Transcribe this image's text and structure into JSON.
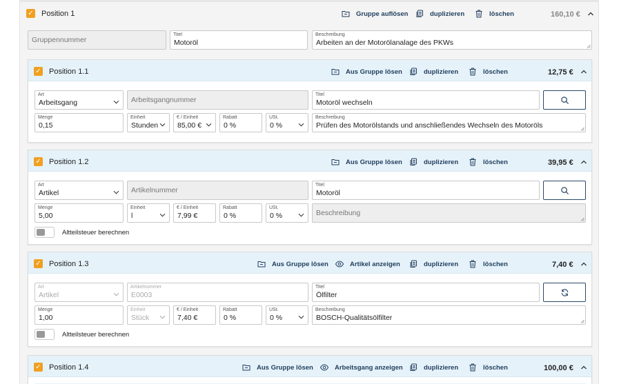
{
  "position1": {
    "title": "Position 1",
    "actions": {
      "dissolve": "Gruppe auflösen",
      "duplicate": "duplizieren",
      "delete": "löschen"
    },
    "price": "160,10 €",
    "group_number": {
      "placeholder": "Gruppennummer"
    },
    "title_field": {
      "label": "Titel",
      "value": "Motoröl"
    },
    "description": {
      "label": "Beschreibung",
      "value": "Arbeiten an der Motorölanalage des PKWs"
    }
  },
  "position1_1": {
    "title": "Position 1.1",
    "actions": {
      "remove": "Aus Gruppe lösen",
      "duplicate": "duplizieren",
      "delete": "löschen"
    },
    "price": "12,75 €",
    "art": {
      "label": "Art",
      "value": "Arbeitsgang"
    },
    "number": {
      "placeholder": "Arbeitsgangnummer"
    },
    "title_field": {
      "label": "Titel",
      "value": "Motoröl wechseln"
    },
    "quantity": {
      "label": "Menge",
      "value": "0,15"
    },
    "unit": {
      "label": "Einheit",
      "value": "Stunden"
    },
    "unit_price": {
      "label": "€ / Einheit",
      "value": "85,00 €"
    },
    "discount": {
      "label": "Rabatt",
      "value": "0 %"
    },
    "vat": {
      "label": "USt.",
      "value": "0 %"
    },
    "description": {
      "label": "Beschreibung",
      "value": "Prüfen des Motorölstands und anschließendes Wechseln des Motoröls"
    }
  },
  "position1_2": {
    "title": "Position 1.2",
    "actions": {
      "remove": "Aus Gruppe lösen",
      "duplicate": "duplizieren",
      "delete": "löschen"
    },
    "price": "39,95 €",
    "art": {
      "label": "Art",
      "value": "Artikel"
    },
    "number": {
      "placeholder": "Artikelnummer"
    },
    "title_field": {
      "label": "Titel",
      "value": "Motoröl"
    },
    "quantity": {
      "label": "Menge",
      "value": "5,00"
    },
    "unit": {
      "label": "Einheit",
      "value": "l"
    },
    "unit_price": {
      "label": "€ / Einheit",
      "value": "7,99 €"
    },
    "discount": {
      "label": "Rabatt",
      "value": "0 %"
    },
    "vat": {
      "label": "USt.",
      "value": "0 %"
    },
    "description": {
      "placeholder": "Beschreibung"
    },
    "toggle_label": "Altteilsteuer berechnen"
  },
  "position1_3": {
    "title": "Position 1.3",
    "actions": {
      "remove": "Aus Gruppe lösen",
      "show": "Artikel anzeigen",
      "duplicate": "duplizieren",
      "delete": "löschen"
    },
    "price": "7,40 €",
    "art": {
      "label": "Art",
      "value": "Artikel"
    },
    "number": {
      "label": "Artikelnummer",
      "value": "E0003"
    },
    "title_field": {
      "label": "Titel",
      "value": "Ölfilter"
    },
    "quantity": {
      "label": "Menge",
      "value": "1,00"
    },
    "unit": {
      "label": "Einheit",
      "value": "Stück"
    },
    "unit_price": {
      "label": "€ / Einheit",
      "value": "7,40 €"
    },
    "discount": {
      "label": "Rabatt",
      "value": "0 %"
    },
    "vat": {
      "label": "USt.",
      "value": "0 %"
    },
    "description": {
      "label": "Beschreibung",
      "value": "BOSCH-Qualitätsölfilter"
    },
    "toggle_label": "Altteilsteuer berechnen"
  },
  "position1_4": {
    "title": "Position 1.4",
    "actions": {
      "remove": "Aus Gruppe lösen",
      "show": "Arbeitsgang anzeigen",
      "duplicate": "duplizieren",
      "delete": "löschen"
    },
    "price": "100,00 €"
  },
  "colors": {
    "accent": "#f0a020",
    "link": "#1f3d5c",
    "header_bg": "#e6f2fa"
  }
}
